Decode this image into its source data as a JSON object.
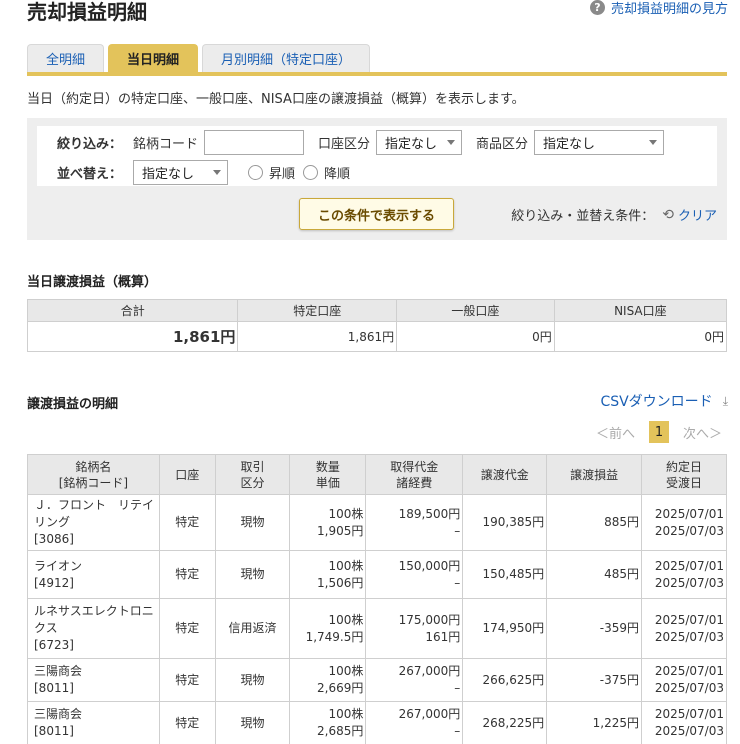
{
  "page_title": "売却損益明細",
  "help_link": "売却損益明細の見方",
  "tabs": [
    {
      "label": "全明細"
    },
    {
      "label": "当日明細"
    },
    {
      "label": "月別明細（特定口座）"
    }
  ],
  "description": "当日（約定日）の特定口座、一般口座、NISA口座の譲渡損益（概算）を表示します。",
  "filter": {
    "label": "絞り込み：",
    "code_label": "銘柄コード",
    "code_value": "",
    "account_label": "口座区分",
    "account_selected": "指定なし",
    "product_label": "商品区分",
    "product_selected": "指定なし"
  },
  "sort": {
    "label": "並べ替え：",
    "selected": "指定なし",
    "asc_label": "昇順",
    "desc_label": "降順"
  },
  "show_button": "この条件で表示する",
  "clear_prefix": "絞り込み・並替え条件：",
  "clear_label": "クリア",
  "summary": {
    "title": "当日譲渡損益（概算）",
    "headers": [
      "合計",
      "特定口座",
      "一般口座",
      "NISA口座"
    ],
    "values": [
      "1,861円",
      "1,861円",
      "0円",
      "0円"
    ]
  },
  "detail": {
    "title": "譲渡損益の明細",
    "csv_label": "CSVダウンロード",
    "pager": {
      "prev": "＜前へ",
      "current": "1",
      "next": "次へ＞"
    },
    "headers": {
      "name": [
        "銘柄名",
        "[銘柄コード]"
      ],
      "account": "口座",
      "trade": [
        "取引",
        "区分"
      ],
      "qty": [
        "数量",
        "単価"
      ],
      "cost": [
        "取得代金",
        "諸経費"
      ],
      "proceeds": "譲渡代金",
      "pl": "譲渡損益",
      "date": [
        "約定日",
        "受渡日"
      ]
    },
    "rows": [
      {
        "name": "Ｊ．フロント　リテイリング",
        "code": "[3086]",
        "account": "特定",
        "trade": "現物",
        "qty": "100株",
        "price": "1,905円",
        "cost": "189,500円",
        "fee": "–",
        "proceeds": "190,385円",
        "pl": "885円",
        "trade_date": "2025/07/01",
        "settle_date": "2025/07/03"
      },
      {
        "name": "ライオン",
        "code": "[4912]",
        "account": "特定",
        "trade": "現物",
        "qty": "100株",
        "price": "1,506円",
        "cost": "150,000円",
        "fee": "–",
        "proceeds": "150,485円",
        "pl": "485円",
        "trade_date": "2025/07/01",
        "settle_date": "2025/07/03"
      },
      {
        "name": "ルネサスエレクトロニクス",
        "code": "[6723]",
        "account": "特定",
        "trade": "信用返済",
        "qty": "100株",
        "price": "1,749.5円",
        "cost": "175,000円",
        "fee": "161円",
        "proceeds": "174,950円",
        "pl": "-359円",
        "trade_date": "2025/07/01",
        "settle_date": "2025/07/03"
      },
      {
        "name": "三陽商会",
        "code": "[8011]",
        "account": "特定",
        "trade": "現物",
        "qty": "100株",
        "price": "2,669円",
        "cost": "267,000円",
        "fee": "–",
        "proceeds": "266,625円",
        "pl": "-375円",
        "trade_date": "2025/07/01",
        "settle_date": "2025/07/03"
      },
      {
        "name": "三陽商会",
        "code": "[8011]",
        "account": "特定",
        "trade": "現物",
        "qty": "100株",
        "price": "2,685円",
        "cost": "267,000円",
        "fee": "–",
        "proceeds": "268,225円",
        "pl": "1,225円",
        "trade_date": "2025/07/01",
        "settle_date": "2025/07/03"
      }
    ]
  },
  "colors": {
    "accent": "#e3c35b",
    "link": "#1a5fb4",
    "negative": "#d9342b"
  }
}
